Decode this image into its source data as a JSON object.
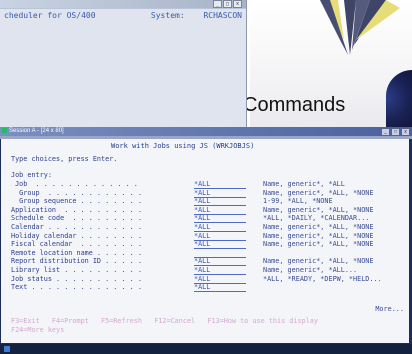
{
  "background": {
    "caption": "Commands",
    "colors": {
      "starburst": "#3f4566",
      "ray_tip": "#e6dd7a",
      "curl": "#1a2255"
    }
  },
  "back_window": {
    "title": "cheduler for OS/400",
    "system_label": "System:",
    "system_value": "RCHASCON",
    "buttons": [
      "_",
      "□",
      "x"
    ]
  },
  "front_window": {
    "title": "Session A - [24 x 80]",
    "buttons": [
      "_",
      "□",
      "x"
    ],
    "screen_title": "Work with Jobs using JS (WRKJOBJS)",
    "instructions": "Type choices, press Enter.",
    "section_label": "Job entry:",
    "rows": [
      {
        "label": " Job  . . . . . . . . . . . . .",
        "value": "*ALL",
        "hint": "Name, generic*, *ALL"
      },
      {
        "label": "  Group  . . . . . . . . . . . .",
        "value": "*ALL",
        "hint": "Name, generic*, *ALL, *NONE"
      },
      {
        "label": "  Group sequence . . . . . . . .",
        "value": "*ALL",
        "hint": "1-99, *ALL, *NONE"
      },
      {
        "label": "Application  . . . . . . . . . .",
        "value": "*ALL",
        "hint": "Name, generic*, *ALL, *NONE"
      },
      {
        "label": "Schedule code  . . . . . . . . .",
        "value": "*ALL",
        "hint": "*ALL, *DAILY, *CALENDAR..."
      },
      {
        "label": "Calendar . . . . . . . . . . . .",
        "value": "*ALL",
        "hint": "Name, generic*, *ALL, *NONE"
      },
      {
        "label": "Holiday calendar . . . . . . . .",
        "value": "*ALL",
        "hint": "Name, generic*, *ALL, *NONE"
      },
      {
        "label": "Fiscal calendar  . . . . . . . .",
        "value": "*ALL",
        "hint": "Name, generic*, *ALL, *NONE"
      },
      {
        "label": "Remote location name . . . . . .",
        "value": "",
        "hint": ""
      },
      {
        "label": "Report distribution ID . . . . .",
        "value": "*ALL",
        "hint": "Name, generic*, *ALL, *NONE"
      },
      {
        "label": "Library list . . . . . . . . . .",
        "value": "*ALL",
        "hint": "Name, generic*, *ALL..."
      },
      {
        "label": "Job status . . . . . . . . . . .",
        "value": "*ALL",
        "hint": "*ALL, *READY, *DEPW, *HELD..."
      },
      {
        "label": "Text . . . . . . . . . . . . . .",
        "value": "*ALL",
        "hint": ""
      }
    ],
    "more_label": "More...",
    "fkeys_line1": "F3=Exit   F4=Prompt   F5=Refresh   F12=Cancel   F13=How to use this display",
    "fkeys_line2": "F24=More keys"
  }
}
